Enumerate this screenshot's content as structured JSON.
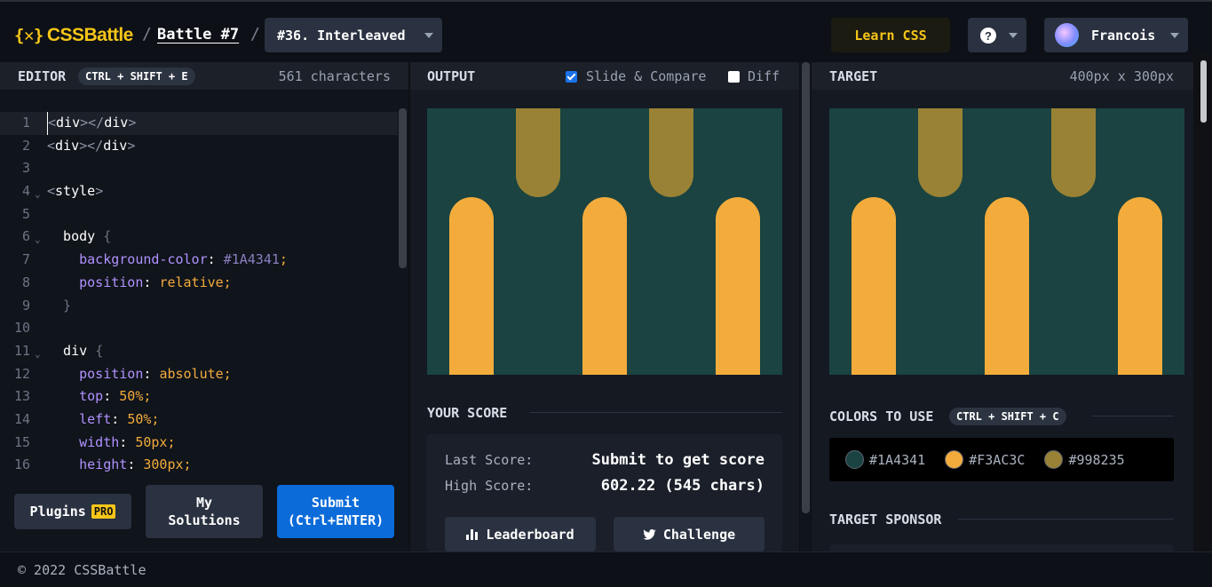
{
  "header": {
    "logo_text": "CSSBattle",
    "logo_mark": "{✕}",
    "separator": "/",
    "battle_link": "Battle #7",
    "target_select": "#36. Interleaved",
    "learn_css": "Learn CSS",
    "help_symbol": "?",
    "user_name": "Francois"
  },
  "editor": {
    "title": "EDITOR",
    "shortcut": "CTRL + SHIFT + E",
    "char_count": "561 characters",
    "lines": [
      {
        "n": "1",
        "parts": [
          [
            "c-tag",
            "<"
          ],
          [
            "c-name",
            "div"
          ],
          [
            "c-tag",
            "></"
          ],
          [
            "c-name",
            "div"
          ],
          [
            "c-tag",
            ">"
          ]
        ]
      },
      {
        "n": "2",
        "parts": [
          [
            "c-tag",
            "<"
          ],
          [
            "c-name",
            "div"
          ],
          [
            "c-tag",
            "></"
          ],
          [
            "c-name",
            "div"
          ],
          [
            "c-tag",
            ">"
          ]
        ]
      },
      {
        "n": "3",
        "parts": []
      },
      {
        "n": "4",
        "fold": true,
        "parts": [
          [
            "c-tag",
            "<"
          ],
          [
            "c-name",
            "style"
          ],
          [
            "c-tag",
            ">"
          ]
        ]
      },
      {
        "n": "5",
        "parts": []
      },
      {
        "n": "6",
        "fold": true,
        "parts": [
          [
            "c-name",
            "  body "
          ],
          [
            "c-punc",
            "{"
          ]
        ]
      },
      {
        "n": "7",
        "parts": [
          [
            "c-prop",
            "    background-color"
          ],
          [
            "c-name",
            ": "
          ],
          [
            "c-hex",
            "#1A4341"
          ],
          [
            "c-val",
            ";"
          ]
        ]
      },
      {
        "n": "8",
        "parts": [
          [
            "c-prop",
            "    position"
          ],
          [
            "c-name",
            ": "
          ],
          [
            "c-val",
            "relative;"
          ]
        ]
      },
      {
        "n": "9",
        "parts": [
          [
            "c-punc",
            "  }"
          ]
        ]
      },
      {
        "n": "10",
        "parts": []
      },
      {
        "n": "11",
        "fold": true,
        "parts": [
          [
            "c-name",
            "  div "
          ],
          [
            "c-punc",
            "{"
          ]
        ]
      },
      {
        "n": "12",
        "parts": [
          [
            "c-prop",
            "    position"
          ],
          [
            "c-name",
            ": "
          ],
          [
            "c-val",
            "absolute;"
          ]
        ]
      },
      {
        "n": "13",
        "parts": [
          [
            "c-prop",
            "    top"
          ],
          [
            "c-name",
            ": "
          ],
          [
            "c-val",
            "50%;"
          ]
        ]
      },
      {
        "n": "14",
        "parts": [
          [
            "c-prop",
            "    left"
          ],
          [
            "c-name",
            ": "
          ],
          [
            "c-val",
            "50%;"
          ]
        ]
      },
      {
        "n": "15",
        "parts": [
          [
            "c-prop",
            "    width"
          ],
          [
            "c-name",
            ": "
          ],
          [
            "c-val",
            "50px;"
          ]
        ]
      },
      {
        "n": "16",
        "parts": [
          [
            "c-prop",
            "    height"
          ],
          [
            "c-name",
            ": "
          ],
          [
            "c-val",
            "300px;"
          ]
        ]
      }
    ],
    "plugins_label": "Plugins",
    "pro_badge": "PRO",
    "my_solutions_line1": "My",
    "my_solutions_line2": "Solutions",
    "submit_line1": "Submit",
    "submit_line2": "(Ctrl+ENTER)"
  },
  "output": {
    "title": "OUTPUT",
    "slide_compare_label": "Slide & Compare",
    "slide_compare_checked": true,
    "diff_label": "Diff",
    "diff_checked": false,
    "your_score_title": "YOUR SCORE",
    "last_score_label": "Last Score:",
    "last_score_value": "Submit to get score",
    "high_score_label": "High Score:",
    "high_score_value": "602.22 (545 chars)",
    "leaderboard_label": "Leaderboard",
    "challenge_label": "Challenge"
  },
  "target": {
    "title": "TARGET",
    "dimensions": "400px x 300px",
    "colors_title": "COLORS TO USE",
    "colors_shortcut": "CTRL + SHIFT + C",
    "colors": [
      "#1A4341",
      "#F3AC3C",
      "#998235"
    ],
    "sponsor_title": "TARGET SPONSOR"
  },
  "footer": {
    "copyright": "© 2022 CSSBattle"
  },
  "accent_colors": {
    "brand_yellow": "#f5c518",
    "submit_blue": "#0b6bd8",
    "canvas_bg": "#1A4341",
    "orange": "#F3AC3C",
    "olive": "#998235"
  }
}
